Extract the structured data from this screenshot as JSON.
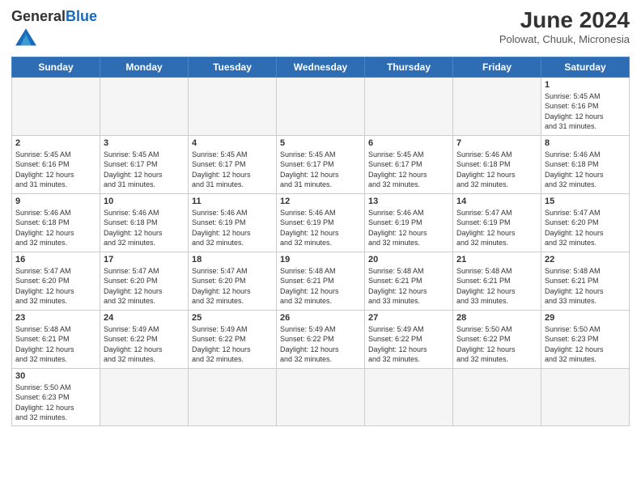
{
  "header": {
    "logo_general": "General",
    "logo_blue": "Blue",
    "month_title": "June 2024",
    "location": "Polowat, Chuuk, Micronesia"
  },
  "days_of_week": [
    "Sunday",
    "Monday",
    "Tuesday",
    "Wednesday",
    "Thursday",
    "Friday",
    "Saturday"
  ],
  "weeks": [
    [
      {
        "day": "",
        "empty": true
      },
      {
        "day": "",
        "empty": true
      },
      {
        "day": "",
        "empty": true
      },
      {
        "day": "",
        "empty": true
      },
      {
        "day": "",
        "empty": true
      },
      {
        "day": "",
        "empty": true
      },
      {
        "day": "1",
        "sunrise": "5:45 AM",
        "sunset": "6:16 PM",
        "daylight": "12 hours and 31 minutes."
      }
    ],
    [
      {
        "day": "2",
        "sunrise": "5:45 AM",
        "sunset": "6:16 PM",
        "daylight": "12 hours and 31 minutes."
      },
      {
        "day": "3",
        "sunrise": "5:45 AM",
        "sunset": "6:17 PM",
        "daylight": "12 hours and 31 minutes."
      },
      {
        "day": "4",
        "sunrise": "5:45 AM",
        "sunset": "6:17 PM",
        "daylight": "12 hours and 31 minutes."
      },
      {
        "day": "5",
        "sunrise": "5:45 AM",
        "sunset": "6:17 PM",
        "daylight": "12 hours and 31 minutes."
      },
      {
        "day": "6",
        "sunrise": "5:45 AM",
        "sunset": "6:17 PM",
        "daylight": "12 hours and 32 minutes."
      },
      {
        "day": "7",
        "sunrise": "5:46 AM",
        "sunset": "6:18 PM",
        "daylight": "12 hours and 32 minutes."
      },
      {
        "day": "8",
        "sunrise": "5:46 AM",
        "sunset": "6:18 PM",
        "daylight": "12 hours and 32 minutes."
      }
    ],
    [
      {
        "day": "9",
        "sunrise": "5:46 AM",
        "sunset": "6:18 PM",
        "daylight": "12 hours and 32 minutes."
      },
      {
        "day": "10",
        "sunrise": "5:46 AM",
        "sunset": "6:18 PM",
        "daylight": "12 hours and 32 minutes."
      },
      {
        "day": "11",
        "sunrise": "5:46 AM",
        "sunset": "6:19 PM",
        "daylight": "12 hours and 32 minutes."
      },
      {
        "day": "12",
        "sunrise": "5:46 AM",
        "sunset": "6:19 PM",
        "daylight": "12 hours and 32 minutes."
      },
      {
        "day": "13",
        "sunrise": "5:46 AM",
        "sunset": "6:19 PM",
        "daylight": "12 hours and 32 minutes."
      },
      {
        "day": "14",
        "sunrise": "5:47 AM",
        "sunset": "6:19 PM",
        "daylight": "12 hours and 32 minutes."
      },
      {
        "day": "15",
        "sunrise": "5:47 AM",
        "sunset": "6:20 PM",
        "daylight": "12 hours and 32 minutes."
      }
    ],
    [
      {
        "day": "16",
        "sunrise": "5:47 AM",
        "sunset": "6:20 PM",
        "daylight": "12 hours and 32 minutes."
      },
      {
        "day": "17",
        "sunrise": "5:47 AM",
        "sunset": "6:20 PM",
        "daylight": "12 hours and 32 minutes."
      },
      {
        "day": "18",
        "sunrise": "5:47 AM",
        "sunset": "6:20 PM",
        "daylight": "12 hours and 32 minutes."
      },
      {
        "day": "19",
        "sunrise": "5:48 AM",
        "sunset": "6:21 PM",
        "daylight": "12 hours and 32 minutes."
      },
      {
        "day": "20",
        "sunrise": "5:48 AM",
        "sunset": "6:21 PM",
        "daylight": "12 hours and 33 minutes."
      },
      {
        "day": "21",
        "sunrise": "5:48 AM",
        "sunset": "6:21 PM",
        "daylight": "12 hours and 33 minutes."
      },
      {
        "day": "22",
        "sunrise": "5:48 AM",
        "sunset": "6:21 PM",
        "daylight": "12 hours and 33 minutes."
      }
    ],
    [
      {
        "day": "23",
        "sunrise": "5:48 AM",
        "sunset": "6:21 PM",
        "daylight": "12 hours and 32 minutes."
      },
      {
        "day": "24",
        "sunrise": "5:49 AM",
        "sunset": "6:22 PM",
        "daylight": "12 hours and 32 minutes."
      },
      {
        "day": "25",
        "sunrise": "5:49 AM",
        "sunset": "6:22 PM",
        "daylight": "12 hours and 32 minutes."
      },
      {
        "day": "26",
        "sunrise": "5:49 AM",
        "sunset": "6:22 PM",
        "daylight": "12 hours and 32 minutes."
      },
      {
        "day": "27",
        "sunrise": "5:49 AM",
        "sunset": "6:22 PM",
        "daylight": "12 hours and 32 minutes."
      },
      {
        "day": "28",
        "sunrise": "5:50 AM",
        "sunset": "6:22 PM",
        "daylight": "12 hours and 32 minutes."
      },
      {
        "day": "29",
        "sunrise": "5:50 AM",
        "sunset": "6:23 PM",
        "daylight": "12 hours and 32 minutes."
      }
    ],
    [
      {
        "day": "30",
        "sunrise": "5:50 AM",
        "sunset": "6:23 PM",
        "daylight": "12 hours and 32 minutes."
      },
      {
        "day": "",
        "empty": true
      },
      {
        "day": "",
        "empty": true
      },
      {
        "day": "",
        "empty": true
      },
      {
        "day": "",
        "empty": true
      },
      {
        "day": "",
        "empty": true
      },
      {
        "day": "",
        "empty": true
      }
    ]
  ],
  "labels": {
    "sunrise": "Sunrise:",
    "sunset": "Sunset:",
    "daylight": "Daylight:"
  }
}
